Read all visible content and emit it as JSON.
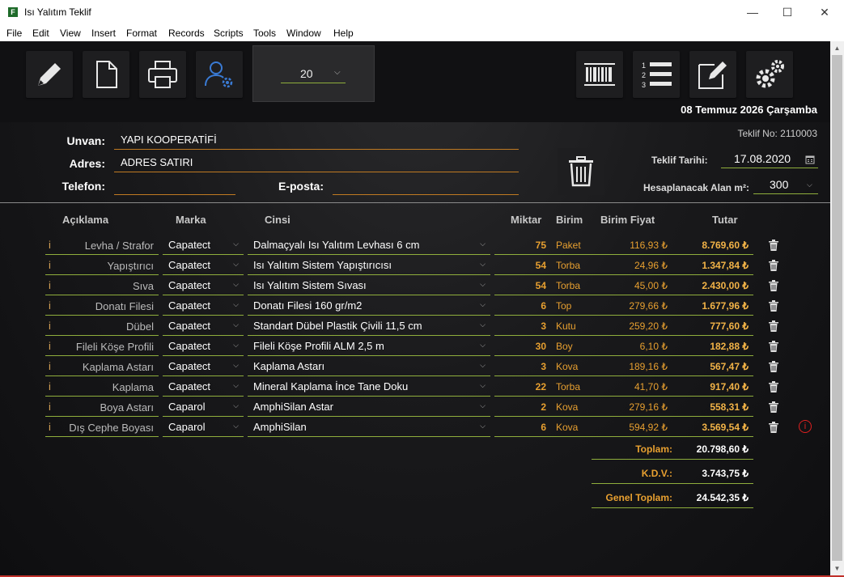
{
  "window": {
    "title": "Isı Yalıtım Teklif",
    "minimize": "—",
    "maximize": "☐",
    "close": "✕"
  },
  "menu": [
    "File",
    "Edit",
    "View",
    "Insert",
    "Format",
    "Records",
    "Scripts",
    "Tools",
    "Window",
    "Help"
  ],
  "toolbar": {
    "quantity_value": "20"
  },
  "header": {
    "date_long": "08 Temmuz 2026 Çarşamba",
    "teklif_no": "Teklif No: 2110003",
    "teklif_tarihi_label": "Teklif Tarihi:",
    "teklif_tarihi": "17.08.2020",
    "alan_label": "Hesaplanacak Alan m²:",
    "alan_value": "300"
  },
  "customer": {
    "unvan_label": "Unvan:",
    "unvan": "YAPI KOOPERATİFİ",
    "adres_label": "Adres:",
    "adres": "ADRES SATIRI",
    "telefon_label": "Telefon:",
    "telefon": "",
    "eposta_label": "E-posta:",
    "eposta": ""
  },
  "table": {
    "headers": {
      "aciklama": "Açıklama",
      "marka": "Marka",
      "cinsi": "Cinsi",
      "miktar": "Miktar",
      "birim": "Birim",
      "birim_fiyat": "Birim Fiyat",
      "tutar": "Tutar"
    },
    "rows": [
      {
        "aciklama": "Levha / Strafor",
        "marka": "Capatect",
        "cinsi": "Dalmaçyalı Isı Yalıtım Levhası 6 cm",
        "miktar": "75",
        "birim": "Paket",
        "birim_fiyat": "116,93 ₺",
        "tutar": "8.769,60 ₺"
      },
      {
        "aciklama": "Yapıştırıcı",
        "marka": "Capatect",
        "cinsi": "Isı Yalıtım Sistem Yapıştırıcısı",
        "miktar": "54",
        "birim": "Torba",
        "birim_fiyat": "24,96 ₺",
        "tutar": "1.347,84 ₺"
      },
      {
        "aciklama": "Sıva",
        "marka": "Capatect",
        "cinsi": "Isı Yalıtım Sistem Sıvası",
        "miktar": "54",
        "birim": "Torba",
        "birim_fiyat": "45,00 ₺",
        "tutar": "2.430,00 ₺"
      },
      {
        "aciklama": "Donatı Filesi",
        "marka": "Capatect",
        "cinsi": "Donatı Filesi 160 gr/m2",
        "miktar": "6",
        "birim": "Top",
        "birim_fiyat": "279,66 ₺",
        "tutar": "1.677,96 ₺"
      },
      {
        "aciklama": "Dübel",
        "marka": "Capatect",
        "cinsi": "Standart Dübel Plastik Çivili 11,5 cm",
        "miktar": "3",
        "birim": "Kutu",
        "birim_fiyat": "259,20 ₺",
        "tutar": "777,60 ₺"
      },
      {
        "aciklama": "Fileli Köşe Profili",
        "marka": "Capatect",
        "cinsi": "Fileli Köşe Profili ALM 2,5 m",
        "miktar": "30",
        "birim": "Boy",
        "birim_fiyat": "6,10 ₺",
        "tutar": "182,88 ₺"
      },
      {
        "aciklama": "Kaplama Astarı",
        "marka": "Capatect",
        "cinsi": "Kaplama Astarı",
        "miktar": "3",
        "birim": "Kova",
        "birim_fiyat": "189,16 ₺",
        "tutar": "567,47 ₺"
      },
      {
        "aciklama": "Kaplama",
        "marka": "Capatect",
        "cinsi": "Mineral Kaplama İnce Tane Doku",
        "miktar": "22",
        "birim": "Torba",
        "birim_fiyat": "41,70 ₺",
        "tutar": "917,40 ₺"
      },
      {
        "aciklama": "Boya Astarı",
        "marka": "Caparol",
        "cinsi": "AmphiSilan Astar",
        "miktar": "2",
        "birim": "Kova",
        "birim_fiyat": "279,16 ₺",
        "tutar": "558,31 ₺"
      },
      {
        "aciklama": "Dış Cephe Boyası",
        "marka": "Caparol",
        "cinsi": "AmphiSilan",
        "miktar": "6",
        "birim": "Kova",
        "birim_fiyat": "594,92 ₺",
        "tutar": "3.569,54 ₺"
      }
    ]
  },
  "totals": {
    "toplam_label": "Toplam:",
    "toplam": "20.798,60 ₺",
    "kdv_label": "K.D.V.:",
    "kdv": "3.743,75 ₺",
    "genel_label": "Genel Toplam:",
    "genel": "24.542,35 ₺"
  },
  "icons": {
    "info": "i",
    "warning": "i"
  },
  "colors": {
    "accent_green": "#8fae3c",
    "accent_orange": "#e8a030",
    "field_underline": "#c07a22",
    "user_icon_blue": "#3a7bd5"
  }
}
